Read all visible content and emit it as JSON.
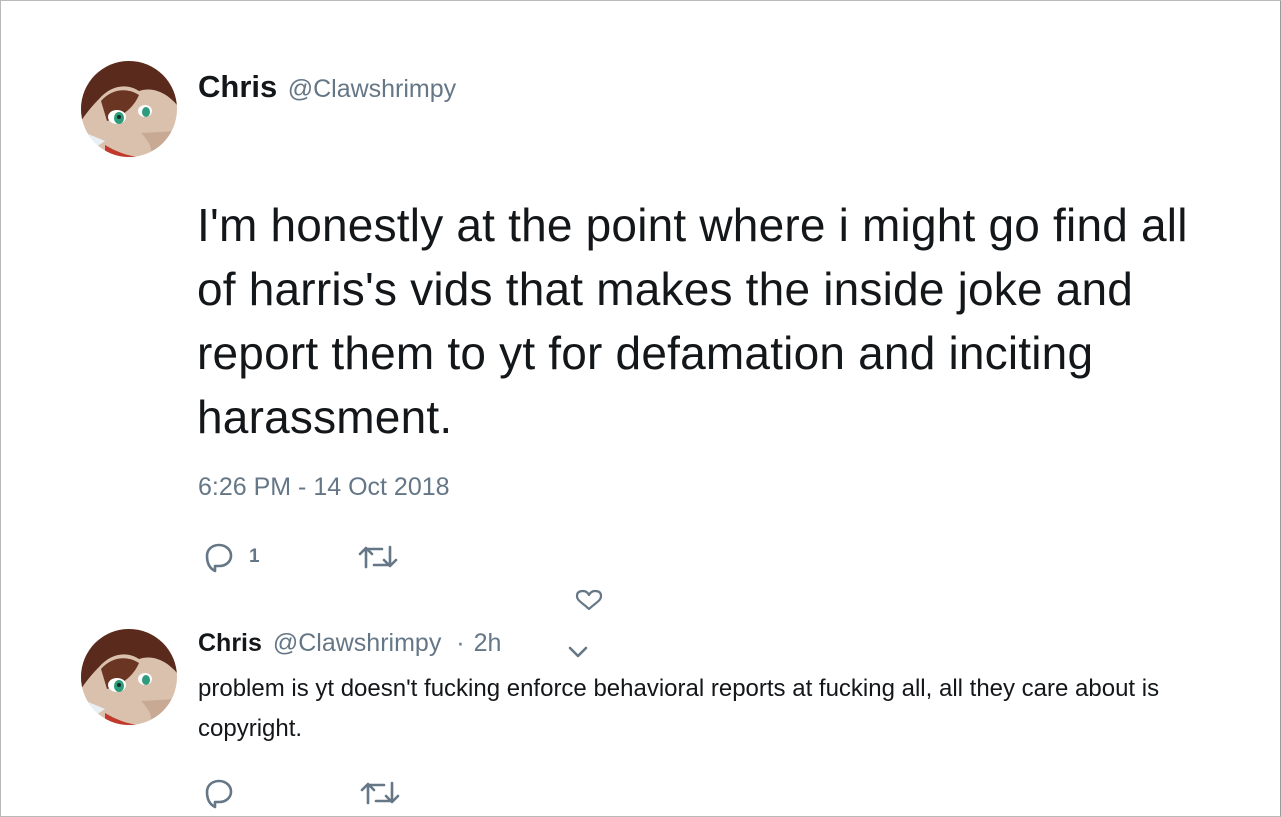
{
  "tweet": {
    "author_name": "Chris",
    "author_handle": "@Clawshrimpy",
    "text": "I'm honestly at the point where i might go find all of harris's vids that makes the inside joke and report them to yt for defamation and inciting harassment.",
    "timestamp": "6:26 PM - 14 Oct 2018",
    "reply_count": "1"
  },
  "reply": {
    "author_name": "Chris",
    "author_handle": "@Clawshrimpy",
    "separator": "·",
    "time": "2h",
    "text": "problem is yt doesn't fucking enforce behavioral reports at fucking all, all they care about is copyright."
  },
  "icons": {
    "reply": "reply-icon",
    "retweet": "retweet-icon",
    "heart": "heart-icon",
    "chevron": "chevron-down-icon"
  },
  "colors": {
    "text": "#14171a",
    "secondary": "#657786",
    "icon": "#657786"
  }
}
